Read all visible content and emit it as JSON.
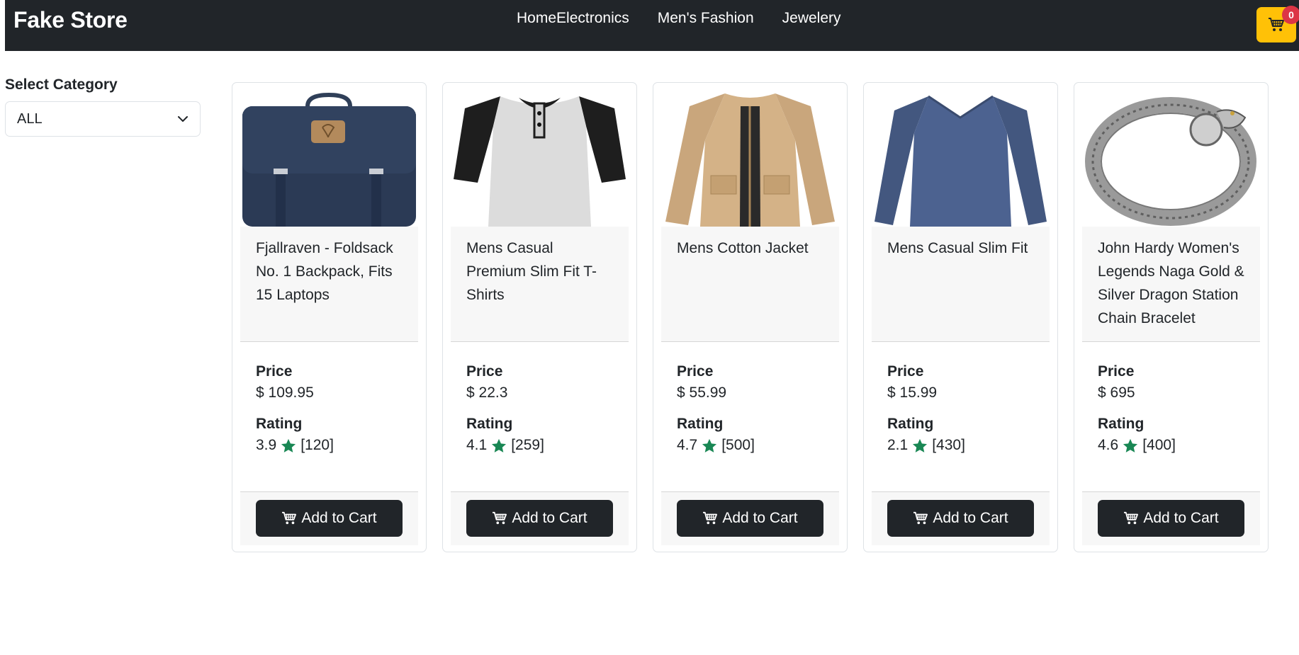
{
  "navbar": {
    "brand": "Fake Store",
    "links": [
      "Home",
      "Electronics",
      "Men's Fashion",
      "Jewelery"
    ],
    "cart_count": "0"
  },
  "sidebar": {
    "title": "Select Category",
    "select_value": "ALL"
  },
  "labels": {
    "price": "Price",
    "rating": "Rating",
    "add_to_cart": "Add to Cart"
  },
  "colors": {
    "navbar_bg": "#212529",
    "cart_button": "#ffc107",
    "badge": "#dc3545",
    "star": "#198754"
  },
  "products": [
    {
      "title": "Fjallraven - Foldsack No. 1 Backpack, Fits 15 Laptops",
      "price": "$ 109.95",
      "rate": "3.9",
      "count": "[120]",
      "image": "backpack"
    },
    {
      "title": "Mens Casual Premium Slim Fit T-Shirts",
      "price": "$ 22.3",
      "rate": "4.1",
      "count": "[259]",
      "image": "tshirt"
    },
    {
      "title": "Mens Cotton Jacket",
      "price": "$ 55.99",
      "rate": "4.7",
      "count": "[500]",
      "image": "jacket"
    },
    {
      "title": "Mens Casual Slim Fit",
      "price": "$ 15.99",
      "rate": "2.1",
      "count": "[430]",
      "image": "longsleeve"
    },
    {
      "title": "John Hardy Women's Legends Naga Gold & Silver Dragon Station Chain Bracelet",
      "price": "$ 695",
      "rate": "4.6",
      "count": "[400]",
      "image": "bracelet"
    }
  ]
}
